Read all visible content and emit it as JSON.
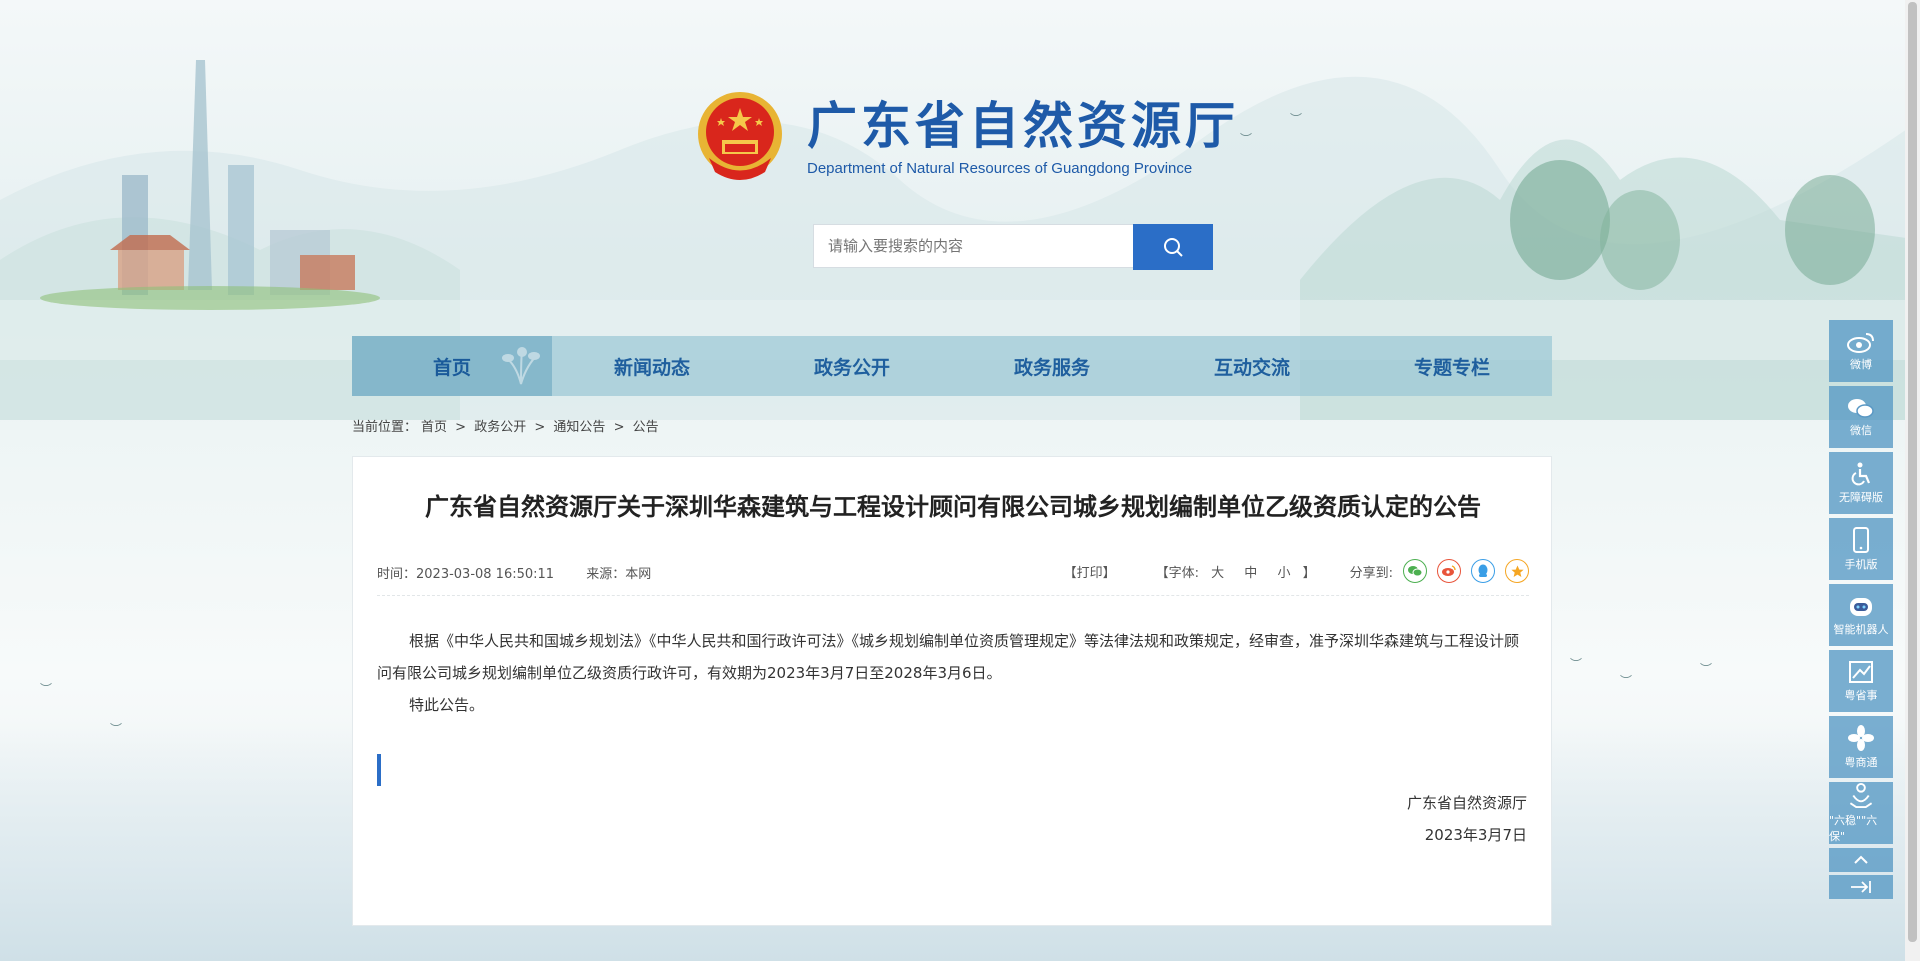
{
  "header": {
    "title": "广东省自然资源厅",
    "subtitle": "Department of Natural Resources of Guangdong Province"
  },
  "search": {
    "placeholder": "请输入要搜索的内容",
    "button_icon": "search-icon"
  },
  "nav": {
    "items": [
      {
        "label": "首页",
        "active": true
      },
      {
        "label": "新闻动态"
      },
      {
        "label": "政务公开"
      },
      {
        "label": "政务服务"
      },
      {
        "label": "互动交流"
      },
      {
        "label": "专题专栏"
      }
    ]
  },
  "breadcrumb": {
    "prefix": "当前位置：",
    "items": [
      "首页",
      "政务公开",
      "通知公告",
      "公告"
    ],
    "sep": ">"
  },
  "article": {
    "title": "广东省自然资源厅关于深圳华森建筑与工程设计顾问有限公司城乡规划编制单位乙级资质认定的公告",
    "time": "时间：2023-03-08 16:50:11",
    "source": "来源：本网",
    "print": "【打印】",
    "font_prefix": "【字体:",
    "font_large": "大",
    "font_medium": "中",
    "font_small": "小",
    "font_suffix": "】",
    "share_label": "分享到:",
    "paragraph1": "根据《中华人民共和国城乡规划法》《中华人民共和国行政许可法》《城乡规划编制单位资质管理规定》等法律法规和政策规定，经审查，准予深圳华森建筑与工程设计顾问有限公司城乡规划编制单位乙级资质行政许可，有效期为2023年3月7日至2028年3月6日。",
    "paragraph2": "特此公告。",
    "signer": "广东省自然资源厅",
    "date": "2023年3月7日"
  },
  "sidebar": {
    "items": [
      {
        "label": "微博",
        "icon": "weibo-icon"
      },
      {
        "label": "微信",
        "icon": "wechat-icon"
      },
      {
        "label": "无障碍版",
        "icon": "accessibility-icon"
      },
      {
        "label": "手机版",
        "icon": "mobile-icon"
      },
      {
        "label": "智能机器人",
        "icon": "robot-icon"
      },
      {
        "label": "粤省事",
        "icon": "yueshengshi-icon"
      },
      {
        "label": "粤商通",
        "icon": "yueshangtong-icon"
      },
      {
        "label": "\"六稳\"\"六保\"",
        "icon": "liuwen-icon"
      }
    ]
  },
  "colors": {
    "brand": "#1e5aa8",
    "accent": "#2b6ec7",
    "nav_bg": "#9bc7d6"
  }
}
